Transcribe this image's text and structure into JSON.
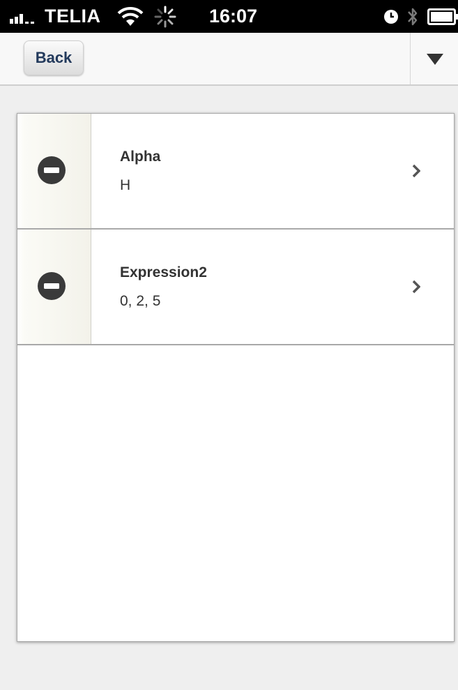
{
  "status_bar": {
    "carrier": "TELIA",
    "time": "16:07",
    "icons": [
      "signal-icon",
      "wifi-icon",
      "activity-spinner-icon",
      "alarm-clock-icon",
      "bluetooth-icon",
      "battery-icon"
    ]
  },
  "nav": {
    "back_label": "Back",
    "menu_icon": "triangle-down-icon"
  },
  "list": {
    "items": [
      {
        "title": "Alpha",
        "subtitle": "H"
      },
      {
        "title": "Expression2",
        "subtitle": "0, 2, 5"
      }
    ]
  },
  "colors": {
    "nav_button_text": "#233a5c",
    "delete_icon": "#3a3a3a",
    "text": "#333333",
    "background": "#efefef"
  }
}
